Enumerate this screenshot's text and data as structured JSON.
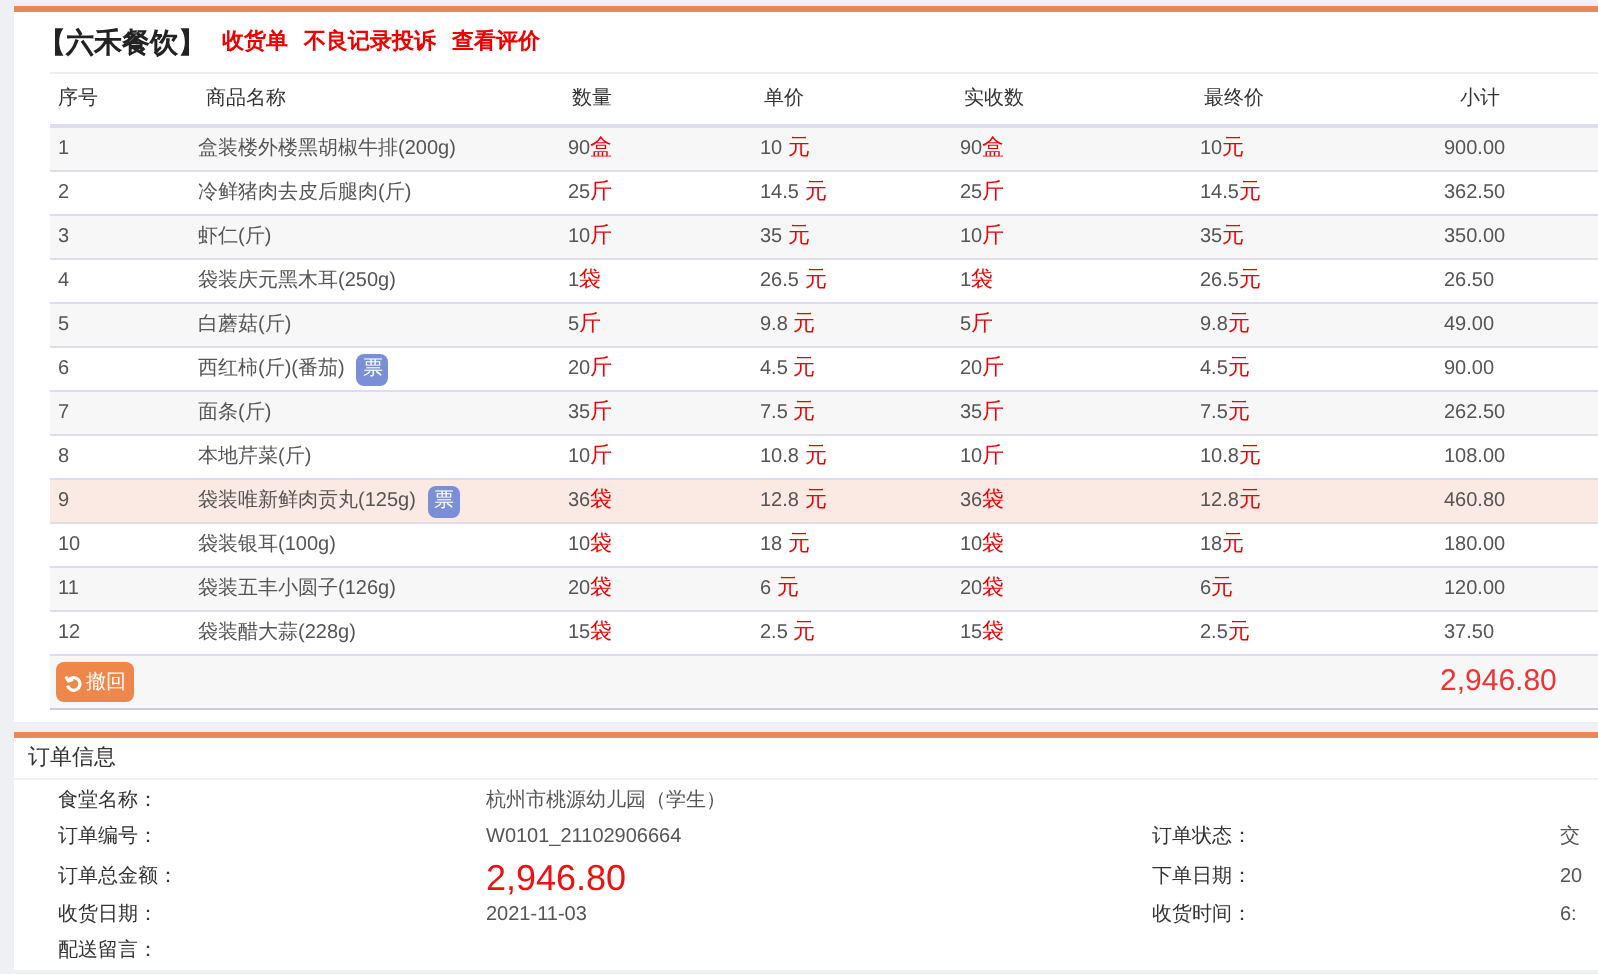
{
  "header": {
    "title": "【六禾餐饮】",
    "links": [
      "收货单",
      "不良记录投诉",
      "查看评价"
    ]
  },
  "table": {
    "columns": [
      "序号",
      "商品名称",
      "数量",
      "单价",
      "实收数",
      "最终价",
      "小计"
    ],
    "rows": [
      {
        "no": "1",
        "name": "盒装楼外楼黑胡椒牛排(200g)",
        "selected": false,
        "qty": {
          "value": "90",
          "unit": "盒"
        },
        "price": {
          "value": "10",
          "unit": "元"
        },
        "received": {
          "value": "90",
          "unit": "盒"
        },
        "final": {
          "value": "10",
          "unit": "元"
        },
        "subtotal": "900.00"
      },
      {
        "no": "2",
        "name": "冷鲜猪肉去皮后腿肉(斤)",
        "selected": false,
        "qty": {
          "value": "25",
          "unit": "斤"
        },
        "price": {
          "value": "14.5",
          "unit": "元"
        },
        "received": {
          "value": "25",
          "unit": "斤"
        },
        "final": {
          "value": "14.5",
          "unit": "元"
        },
        "subtotal": "362.50"
      },
      {
        "no": "3",
        "name": "虾仁(斤)",
        "selected": false,
        "qty": {
          "value": "10",
          "unit": "斤"
        },
        "price": {
          "value": "35",
          "unit": "元"
        },
        "received": {
          "value": "10",
          "unit": "斤"
        },
        "final": {
          "value": "35",
          "unit": "元"
        },
        "subtotal": "350.00"
      },
      {
        "no": "4",
        "name": "袋装庆元黑木耳(250g)",
        "selected": false,
        "qty": {
          "value": "1",
          "unit": "袋"
        },
        "price": {
          "value": "26.5",
          "unit": "元"
        },
        "received": {
          "value": "1",
          "unit": "袋"
        },
        "final": {
          "value": "26.5",
          "unit": "元"
        },
        "subtotal": "26.50"
      },
      {
        "no": "5",
        "name": "白蘑菇(斤)",
        "selected": false,
        "qty": {
          "value": "5",
          "unit": "斤"
        },
        "price": {
          "value": "9.8",
          "unit": "元"
        },
        "received": {
          "value": "5",
          "unit": "斤"
        },
        "final": {
          "value": "9.8",
          "unit": "元"
        },
        "subtotal": "49.00"
      },
      {
        "no": "6",
        "name": "西红柿(斤)(番茄)",
        "badge": "票",
        "selected": false,
        "qty": {
          "value": "20",
          "unit": "斤"
        },
        "price": {
          "value": "4.5",
          "unit": "元"
        },
        "received": {
          "value": "20",
          "unit": "斤"
        },
        "final": {
          "value": "4.5",
          "unit": "元"
        },
        "subtotal": "90.00"
      },
      {
        "no": "7",
        "name": "面条(斤)",
        "selected": false,
        "qty": {
          "value": "35",
          "unit": "斤"
        },
        "price": {
          "value": "7.5",
          "unit": "元"
        },
        "received": {
          "value": "35",
          "unit": "斤"
        },
        "final": {
          "value": "7.5",
          "unit": "元"
        },
        "subtotal": "262.50"
      },
      {
        "no": "8",
        "name": "本地芹菜(斤)",
        "selected": false,
        "qty": {
          "value": "10",
          "unit": "斤"
        },
        "price": {
          "value": "10.8",
          "unit": "元"
        },
        "received": {
          "value": "10",
          "unit": "斤"
        },
        "final": {
          "value": "10.8",
          "unit": "元"
        },
        "subtotal": "108.00"
      },
      {
        "no": "9",
        "name": "袋装唯新鲜肉贡丸(125g)",
        "badge": "票",
        "selected": true,
        "qty": {
          "value": "36",
          "unit": "袋"
        },
        "price": {
          "value": "12.8",
          "unit": "元"
        },
        "received": {
          "value": "36",
          "unit": "袋"
        },
        "final": {
          "value": "12.8",
          "unit": "元"
        },
        "subtotal": "460.80"
      },
      {
        "no": "10",
        "name": "袋装银耳(100g)",
        "selected": false,
        "qty": {
          "value": "10",
          "unit": "袋"
        },
        "price": {
          "value": "18",
          "unit": "元"
        },
        "received": {
          "value": "10",
          "unit": "袋"
        },
        "final": {
          "value": "18",
          "unit": "元"
        },
        "subtotal": "180.00"
      },
      {
        "no": "11",
        "name": "袋装五丰小圆子(126g)",
        "selected": false,
        "qty": {
          "value": "20",
          "unit": "袋"
        },
        "price": {
          "value": "6",
          "unit": "元"
        },
        "received": {
          "value": "20",
          "unit": "袋"
        },
        "final": {
          "value": "6",
          "unit": "元"
        },
        "subtotal": "120.00"
      },
      {
        "no": "12",
        "name": "袋装醋大蒜(228g)",
        "selected": false,
        "qty": {
          "value": "15",
          "unit": "袋"
        },
        "price": {
          "value": "2.5",
          "unit": "元"
        },
        "received": {
          "value": "15",
          "unit": "袋"
        },
        "final": {
          "value": "2.5",
          "unit": "元"
        },
        "subtotal": "37.50"
      }
    ],
    "undo_button": "撤回",
    "total": "2,946.80"
  },
  "order_info": {
    "title": "订单信息",
    "rows": [
      {
        "left": {
          "label": "食堂名称：",
          "value": "杭州市桃源幼儿园（学生）"
        }
      },
      {
        "left": {
          "label": "订单编号：",
          "value": "W0101_21102906664"
        },
        "right": {
          "label": "订单状态：",
          "value": "交"
        }
      },
      {
        "left": {
          "label": "订单总金额：",
          "value": "2,946.80",
          "kind": "amount"
        },
        "right": {
          "label": "下单日期：",
          "value": "20"
        }
      },
      {
        "left": {
          "label": "收货日期：",
          "value": "2021-11-03"
        },
        "right": {
          "label": "收货时间：",
          "value": "6:"
        }
      },
      {
        "left": {
          "label": "配送留言："
        }
      }
    ]
  }
}
